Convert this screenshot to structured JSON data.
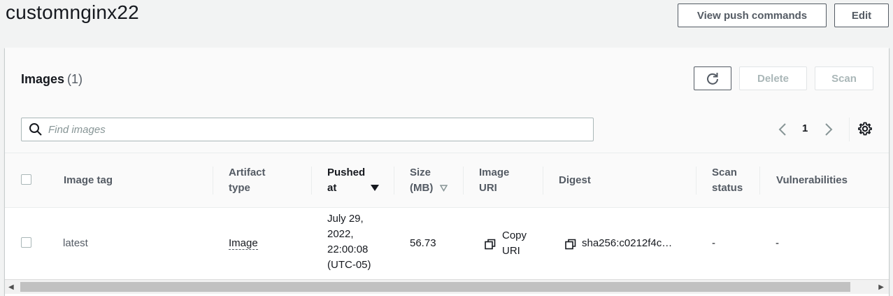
{
  "header": {
    "title": "customnginx22",
    "push_commands_label": "View push commands",
    "edit_label": "Edit"
  },
  "images_panel": {
    "title": "Images",
    "count": "(1)",
    "delete_label": "Delete",
    "scan_label": "Scan",
    "search_placeholder": "Find images",
    "page_number": "1"
  },
  "table": {
    "columns": {
      "image_tag": "Image tag",
      "artifact_type_l1": "Artifact",
      "artifact_type_l2": "type",
      "pushed_at_l1": "Pushed",
      "pushed_at_l2": "at",
      "size_l1": "Size",
      "size_l2": "(MB)",
      "image_uri_l1": "Image",
      "image_uri_l2": "URI",
      "digest": "Digest",
      "scan_status_l1": "Scan",
      "scan_status_l2": "status",
      "vulnerabilities": "Vulnerabilities"
    },
    "rows": [
      {
        "image_tag": "latest",
        "artifact_type": "Image",
        "pushed_at_l1": "July 29,",
        "pushed_at_l2": "2022,",
        "pushed_at_l3": "22:00:08",
        "pushed_at_l4": "(UTC-05)",
        "size": "56.73",
        "copy_uri_l1": "Copy",
        "copy_uri_l2": "URI",
        "digest": "sha256:c0212f4c…",
        "scan_status": "-",
        "vulnerabilities": "-"
      }
    ]
  },
  "colors": {
    "accent_border": "#545b64",
    "disabled_text": "#aab7b8"
  }
}
